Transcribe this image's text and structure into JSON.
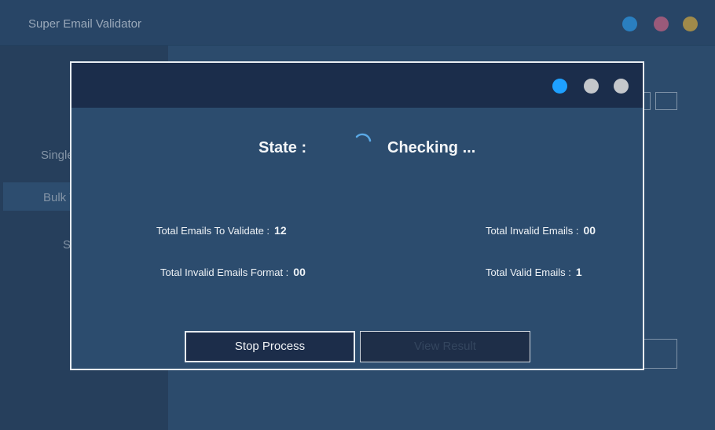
{
  "app": {
    "title": "Super Email Validator",
    "window_buttons": [
      {
        "name": "blue",
        "color": "#2a7fc0"
      },
      {
        "name": "pink",
        "color": "#9a5a7a"
      },
      {
        "name": "gold",
        "color": "#a08a4a"
      }
    ],
    "sidebar": {
      "items": [
        {
          "label": "Single"
        },
        {
          "label": "Bulk V"
        },
        {
          "label": "S"
        }
      ],
      "active_index": 1
    }
  },
  "dialog": {
    "state_label": "State :",
    "state_value": "Checking ...",
    "stats": {
      "total_to_validate_label": "Total Emails To Validate :",
      "total_to_validate_value": "12",
      "total_invalid_format_label": "Total Invalid Emails Format :",
      "total_invalid_format_value": "00",
      "total_invalid_label": "Total Invalid Emails :",
      "total_invalid_value": "00",
      "total_valid_label": "Total Valid Emails :",
      "total_valid_value": "1"
    },
    "buttons": {
      "stop_label": "Stop Process",
      "view_result_label": "View Result"
    },
    "window_buttons": [
      {
        "name": "blue",
        "color": "#1ea0ff"
      },
      {
        "name": "grey-1",
        "color": "#c4c7cb"
      },
      {
        "name": "grey-2",
        "color": "#c4c7cb"
      }
    ],
    "spinner_color": "#5aa9e6"
  }
}
